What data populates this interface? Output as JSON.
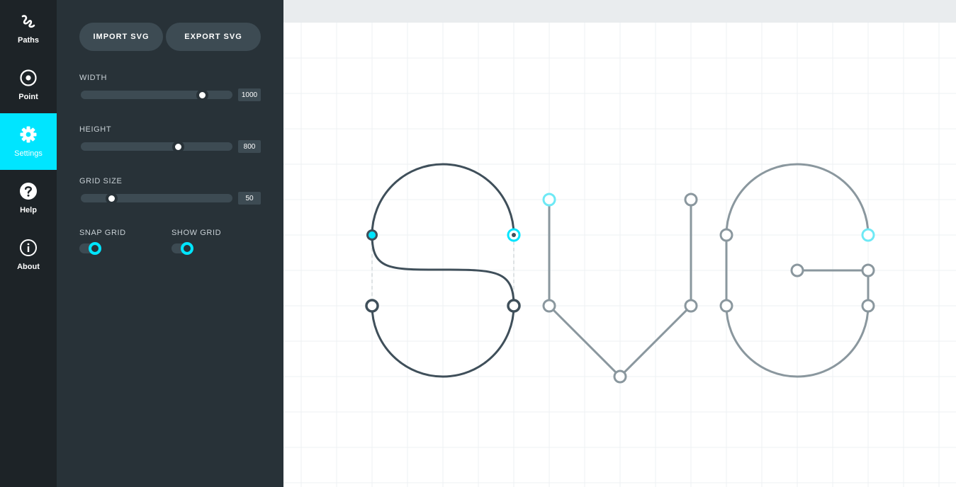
{
  "nav": {
    "items": [
      {
        "label": "Paths",
        "icon": "paths-icon",
        "active": false
      },
      {
        "label": "Point",
        "icon": "point-icon",
        "active": false
      },
      {
        "label": "Settings",
        "icon": "gear-icon",
        "active": true
      },
      {
        "label": "Help",
        "icon": "help-icon",
        "active": false
      },
      {
        "label": "About",
        "icon": "info-icon",
        "active": false
      }
    ]
  },
  "settings": {
    "import_label": "IMPORT SVG",
    "export_label": "EXPORT SVG",
    "width": {
      "label": "WIDTH",
      "value": "1000",
      "min": 0,
      "max": 1250
    },
    "height": {
      "label": "HEIGHT",
      "value": "800",
      "min": 0,
      "max": 1250
    },
    "grid_size": {
      "label": "GRID SIZE",
      "value": "50",
      "min": 0,
      "max": 250
    },
    "snap_grid": {
      "label": "SNAP GRID",
      "on": true
    },
    "show_grid": {
      "label": "SHOW GRID",
      "on": true
    }
  },
  "colors": {
    "accent": "#00e5ff",
    "nav_bg": "#1d2327",
    "panel_bg": "#283238",
    "control_bg": "#3d4b53",
    "active_path": "#3f4f5a",
    "inactive_path": "#8a979e",
    "grid_line": "#eef1f3"
  }
}
